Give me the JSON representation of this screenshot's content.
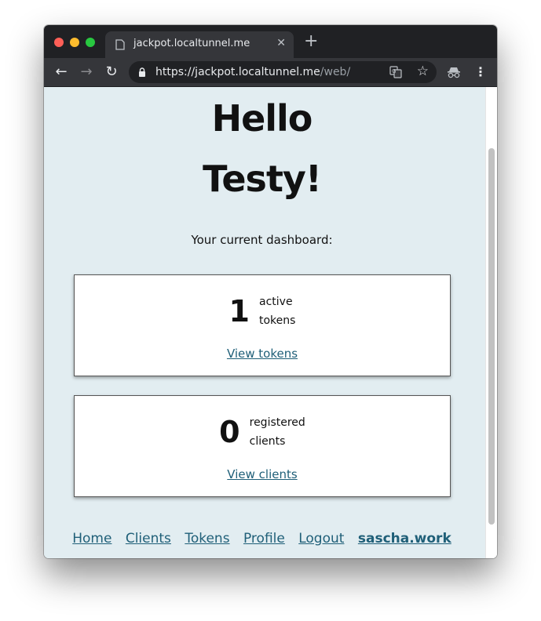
{
  "browser": {
    "tab_title": "jackpot.localtunnel.me",
    "url_host": "https://jackpot.localtunnel.me",
    "url_path": "/web/"
  },
  "page": {
    "greeting": "Hello",
    "user_name": "Testy!",
    "dashboard_label": "Your current dashboard:"
  },
  "cards": {
    "tokens": {
      "count": "1",
      "label_line1": "active",
      "label_line2": "tokens",
      "link": "View tokens"
    },
    "clients": {
      "count": "0",
      "label_line1": "registered",
      "label_line2": "clients",
      "link": "View clients"
    }
  },
  "footer": {
    "home": "Home",
    "clients": "Clients",
    "tokens": "Tokens",
    "profile": "Profile",
    "logout": "Logout",
    "brand": "sascha.work"
  },
  "colors": {
    "page_background": "#e2edf1",
    "link": "#1f5f78",
    "chrome_dark": "#202124"
  },
  "icons": [
    "page-icon",
    "close-icon",
    "plus-icon",
    "back-arrow-icon",
    "forward-arrow-icon",
    "reload-icon",
    "lock-icon",
    "translate-icon",
    "star-icon",
    "incognito-icon",
    "kebab-menu-icon"
  ]
}
